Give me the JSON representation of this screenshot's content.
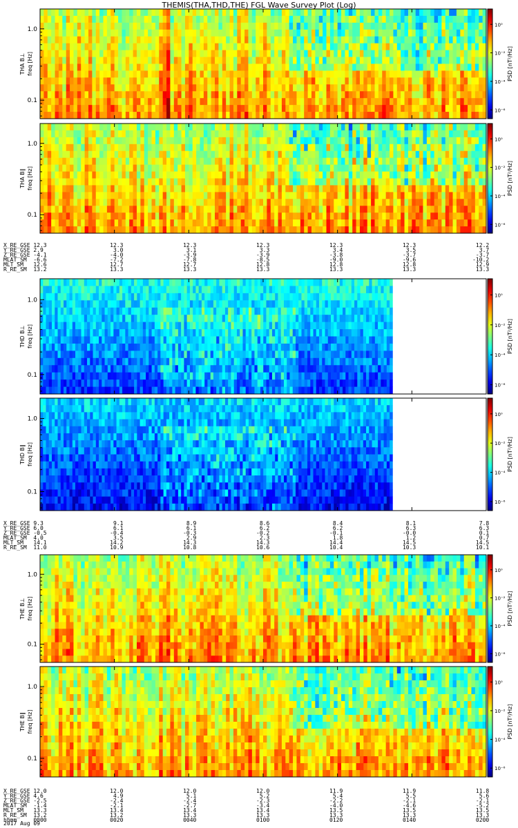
{
  "title": "THEMIS(THA,THD,THE) FGL Wave Survey Plot (Log)",
  "colors": {
    "background": "#ffffff",
    "axis": "#000000"
  },
  "chart_data": {
    "type": "heatmap",
    "title": "THEMIS(THA,THD,THE) FGL Wave Survey Plot (Log)",
    "xlabel": "hhmm",
    "x_ticks": [
      "0000",
      "0020",
      "0040",
      "0100",
      "0120",
      "0140",
      "0200"
    ],
    "date": "2017 Aug 09",
    "y_scale": "log",
    "y_ticks": [
      "0.1",
      "1.0"
    ],
    "ylim_hz": [
      0.055,
      1.9
    ],
    "colorbar_label": "PSD [nT²/Hz]",
    "colorbar_ticks": [
      "10⁰",
      "10⁻²",
      "10⁻⁴",
      "10⁻⁶"
    ],
    "panels": [
      {
        "probe": "THA",
        "label": "THA B⊥",
        "ylabel": "freq [Hz]",
        "data_end_fraction": 1.0
      },
      {
        "probe": "THA",
        "label": "THA B∥",
        "ylabel": "freq [Hz]",
        "data_end_fraction": 1.0
      },
      {
        "probe": "THD",
        "label": "THD B⊥",
        "ylabel": "freq [Hz]",
        "data_end_fraction": 0.79
      },
      {
        "probe": "THD",
        "label": "THD B∥",
        "ylabel": "freq [Hz]",
        "data_end_fraction": 0.79
      },
      {
        "probe": "THE",
        "label": "THE B⊥",
        "ylabel": "freq [Hz]",
        "data_end_fraction": 1.0
      },
      {
        "probe": "THE",
        "label": "THE B∥",
        "ylabel": "freq [Hz]",
        "data_end_fraction": 1.0
      }
    ],
    "ephemeris": [
      {
        "probe": "THA",
        "rows": [
          {
            "name": "X_RE_GSE",
            "values": [
              "12.3",
              "12.3",
              "12.3",
              "12.3",
              "12.3",
              "12.3",
              "12.2"
            ]
          },
          {
            "name": "Y_RE_GSE",
            "values": [
              "2.9",
              "3.0",
              "3.1",
              "3.3",
              "3.4",
              "3.5",
              "3.7"
            ]
          },
          {
            "name": "Z_RE_GSE",
            "values": [
              "-4.1",
              "-4.0",
              "-3.9",
              "-3.9",
              "-3.8",
              "-3.7",
              "-3.7"
            ]
          },
          {
            "name": "MLAT_SM",
            "values": [
              "-6.6",
              "-7.2",
              "-7.8",
              "-8.5",
              "-9.0",
              "-9.6",
              "-10.2"
            ]
          },
          {
            "name": "MLT_SM",
            "values": [
              "12.6",
              "12.7",
              "12.7",
              "12.8",
              "12.8",
              "12.8",
              "12.9"
            ]
          },
          {
            "name": "R_RE_SM",
            "values": [
              "13.2",
              "13.3",
              "13.3",
              "13.3",
              "13.3",
              "13.3",
              "13.3"
            ]
          }
        ]
      },
      {
        "probe": "THD",
        "rows": [
          {
            "name": "X_RE_GSE",
            "values": [
              "9.3",
              "9.1",
              "8.9",
              "8.6",
              "8.4",
              "8.1",
              "7.8"
            ]
          },
          {
            "name": "Y_RE_GSE",
            "values": [
              "6.0",
              "6.1",
              "6.1",
              "6.2",
              "6.2",
              "6.3",
              "6.3"
            ]
          },
          {
            "name": "Z_RE_GSE",
            "values": [
              "-0.5",
              "-0.4",
              "-0.3",
              "-0.2",
              "-0.1",
              "-0.0",
              "0.1"
            ]
          },
          {
            "name": "MLAT_SM",
            "values": [
              "4.0",
              "3.5",
              "2.9",
              "2.3",
              "1.8",
              "1.2",
              "0.7"
            ]
          },
          {
            "name": "MLT_SM",
            "values": [
              "14.1",
              "14.2",
              "14.3",
              "14.3",
              "14.4",
              "14.5",
              "14.5"
            ]
          },
          {
            "name": "R_RE_SM",
            "values": [
              "11.0",
              "10.9",
              "10.8",
              "10.6",
              "10.4",
              "10.3",
              "10.1"
            ]
          }
        ]
      },
      {
        "probe": "THE",
        "rows": [
          {
            "name": "X_RE_GSE",
            "values": [
              "12.0",
              "12.0",
              "12.0",
              "12.0",
              "11.9",
              "11.9",
              "11.8"
            ]
          },
          {
            "name": "Y_RE_GSE",
            "values": [
              "4.6",
              "4.9",
              "5.1",
              "5.2",
              "5.4",
              "5.5",
              "5.6"
            ]
          },
          {
            "name": "Z_RE_GSE",
            "values": [
              "-2.5",
              "-2.4",
              "-2.4",
              "-2.3",
              "-2.2",
              "-2.1",
              "-2.1"
            ]
          },
          {
            "name": "MLAT_SM",
            "values": [
              "-1.4",
              "-2.1",
              "-2.7",
              "-3.4",
              "-4.0",
              "-4.6",
              "-5.2"
            ]
          },
          {
            "name": "MLT_SM",
            "values": [
              "13.3",
              "13.4",
              "13.4",
              "13.4",
              "13.5",
              "13.5",
              "13.5"
            ]
          },
          {
            "name": "R_RE_SM",
            "values": [
              "13.2",
              "13.2",
              "13.3",
              "13.3",
              "13.3",
              "13.3",
              "13.3"
            ]
          }
        ]
      }
    ]
  }
}
